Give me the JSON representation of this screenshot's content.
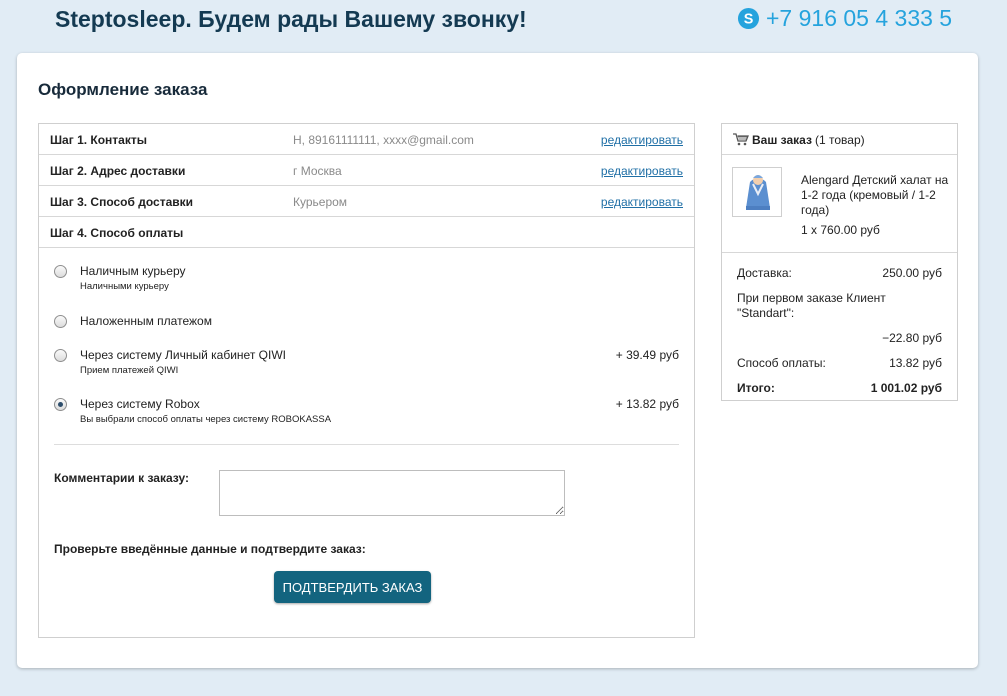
{
  "header": {
    "title": "Steptosleep. Будем рады Вашему звонку!",
    "phone": "+7 916 05 4 333 5",
    "skype_icon": "skype-icon"
  },
  "page_title": "Оформление заказа",
  "steps": [
    {
      "label": "Шаг 1. Контакты",
      "value": "Н, 89161111111, xxxx@gmail.com",
      "edit": "редактировать"
    },
    {
      "label": "Шаг 2. Адрес доставки",
      "value": "г Москва",
      "edit": "редактировать"
    },
    {
      "label": "Шаг 3. Способ доставки",
      "value": "Курьером",
      "edit": "редактировать"
    },
    {
      "label": "Шаг 4. Способ оплаты"
    }
  ],
  "payment_options": [
    {
      "name": "Наличным курьеру",
      "desc": "Наличными курьеру",
      "price": "",
      "checked": false
    },
    {
      "name": "Наложенным платежом",
      "desc": "",
      "price": "",
      "checked": false
    },
    {
      "name": "Через систему Личный кабинет QIWI",
      "desc": "Прием платежей QIWI",
      "price": "+ 39.49 руб",
      "checked": false
    },
    {
      "name": "Через систему Robox",
      "desc": "Вы выбрали способ оплаты через систему ROBOKASSA",
      "price": "+ 13.82 руб",
      "checked": true
    }
  ],
  "comment": {
    "label": "Комментарии к заказу:",
    "value": ""
  },
  "confirm": {
    "hint": "Проверьте введённые данные и подтвердите заказ:",
    "button": "ПОДТВЕРДИТЬ ЗАКАЗ"
  },
  "cart": {
    "title": "Ваш заказ",
    "count": "(1 товар)",
    "icon": "cart-icon",
    "item": {
      "name": "Alengard Детский халат на 1-2 года (кремовый / 1-2 года)",
      "qty": "1 x 760.00 руб"
    },
    "summary": [
      {
        "label": "Доставка:",
        "value": "250.00 руб"
      },
      {
        "label": "При первом заказе Клиент \"Standart\":",
        "value": "−22.80 руб"
      },
      {
        "label": "Способ оплаты:",
        "value": "13.82 руб"
      },
      {
        "label": "Итого:",
        "value": "1 001.02 руб"
      }
    ]
  },
  "colors": {
    "accent": "#13647f",
    "link": "#1f6fa6",
    "phone": "#25a3dd",
    "background": "#e1ecf5"
  }
}
